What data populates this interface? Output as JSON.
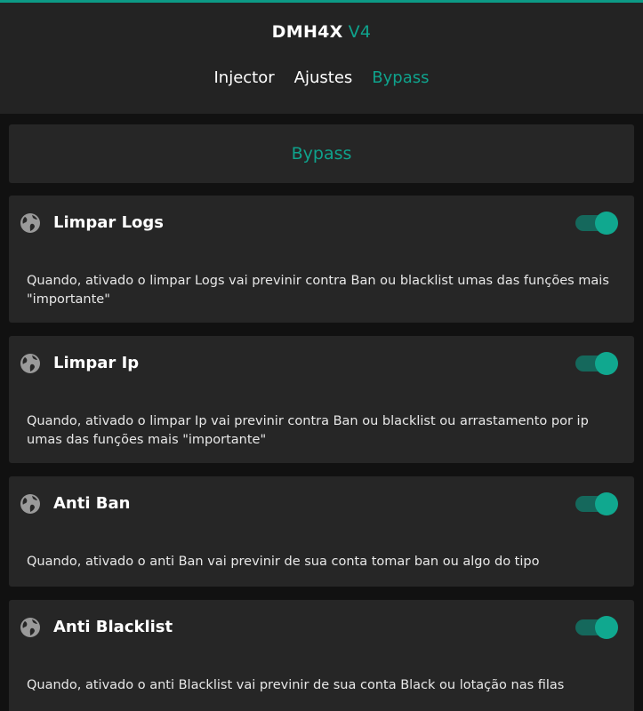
{
  "header": {
    "app_name": "DMH4X",
    "version": "V4",
    "tabs": [
      {
        "label": "Injector",
        "active": false
      },
      {
        "label": "Ajustes",
        "active": false
      },
      {
        "label": "Bypass",
        "active": true
      }
    ]
  },
  "section": {
    "title": "Bypass"
  },
  "options": [
    {
      "icon": "globe-icon",
      "title": "Limpar Logs",
      "enabled": true,
      "description": "Quando, ativado o limpar Logs vai previnir contra Ban ou blacklist umas das funções mais \"importante\""
    },
    {
      "icon": "globe-icon",
      "title": "Limpar Ip",
      "enabled": true,
      "description": "Quando, ativado o limpar Ip vai previnir contra Ban ou blacklist ou arrastamento por ip umas das funções mais \"importante\""
    },
    {
      "icon": "globe-icon",
      "title": "Anti Ban",
      "enabled": true,
      "description": "Quando, ativado o anti Ban vai previnir de sua conta tomar ban ou algo do tipo"
    },
    {
      "icon": "globe-icon",
      "title": "Anti Blacklist",
      "enabled": true,
      "description": "Quando, ativado o anti Blacklist vai previnir de sua conta Black ou lotação nas filas"
    }
  ],
  "colors": {
    "accent": "#0fa28c",
    "toggle_track": "#15685c",
    "toggle_knob": "#10a88f",
    "card_bg": "#262626",
    "page_bg": "#111111"
  }
}
